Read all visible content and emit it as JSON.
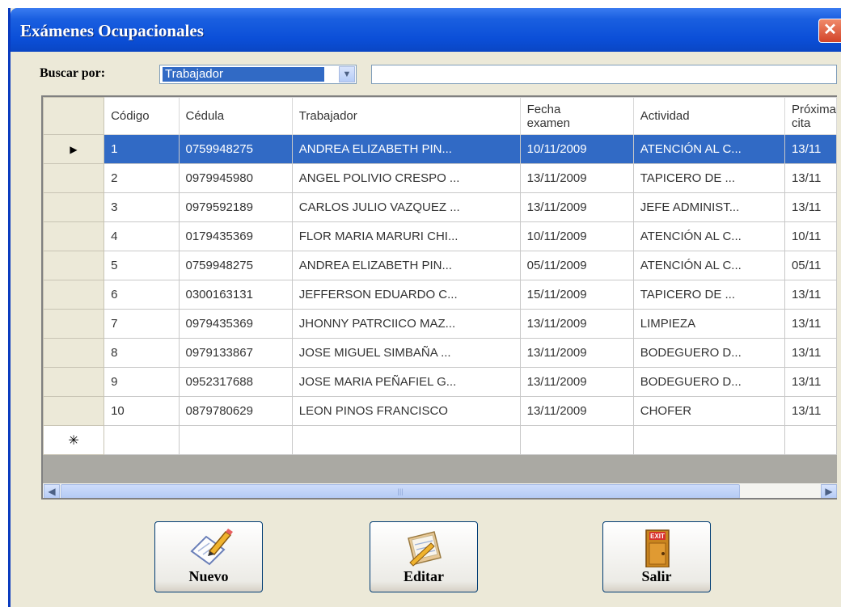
{
  "window": {
    "title": "Exámenes Ocupacionales",
    "close_glyph": "✕"
  },
  "search": {
    "label": "Buscar por:",
    "field": "Trabajador",
    "text": ""
  },
  "grid": {
    "columns": [
      "Código",
      "Cédula",
      "Trabajador",
      "Fecha\nexamen",
      "Actividad",
      "Próxima\ncita"
    ],
    "rows": [
      [
        "1",
        "0759948275",
        "ANDREA ELIZABETH PIN...",
        "10/11/2009",
        "ATENCIÓN AL C...",
        "13/11"
      ],
      [
        "2",
        "0979945980",
        "ANGEL POLIVIO CRESPO ...",
        "13/11/2009",
        "TAPICERO DE ...",
        "13/11"
      ],
      [
        "3",
        "0979592189",
        "CARLOS JULIO VAZQUEZ ...",
        "13/11/2009",
        "JEFE ADMINIST...",
        "13/11"
      ],
      [
        "4",
        "0179435369",
        "FLOR MARIA MARURI CHI...",
        "10/11/2009",
        "ATENCIÓN AL C...",
        "10/11"
      ],
      [
        "5",
        "0759948275",
        "ANDREA ELIZABETH PIN...",
        "05/11/2009",
        "ATENCIÓN AL C...",
        "05/11"
      ],
      [
        "6",
        "0300163131",
        "JEFFERSON EDUARDO C...",
        "15/11/2009",
        "TAPICERO DE ...",
        "13/11"
      ],
      [
        "7",
        "0979435369",
        "JHONNY PATRCIICO MAZ...",
        "13/11/2009",
        "LIMPIEZA",
        "13/11"
      ],
      [
        "8",
        "0979133867",
        "JOSE  MIGUEL SIMBAÑA ...",
        "13/11/2009",
        "BODEGUERO D...",
        "13/11"
      ],
      [
        "9",
        "0952317688",
        "JOSE MARIA PEÑAFIEL G...",
        "13/11/2009",
        "BODEGUERO D...",
        "13/11"
      ],
      [
        "10",
        "0879780629",
        "LEON PINOS FRANCISCO",
        "13/11/2009",
        "CHOFER",
        "13/11"
      ]
    ],
    "selected_row": 0,
    "current_row_glyph": "▶",
    "new_row_glyph": "✳"
  },
  "buttons": {
    "new_label": "Nuevo",
    "edit_label": "Editar",
    "exit_label": "Salir",
    "exit_sign_text": "EXIT"
  },
  "colors": {
    "titlebar": "#0b4fd8",
    "selection": "#316ac5",
    "window_bg": "#ece9d8",
    "close_button": "#d2442a"
  }
}
